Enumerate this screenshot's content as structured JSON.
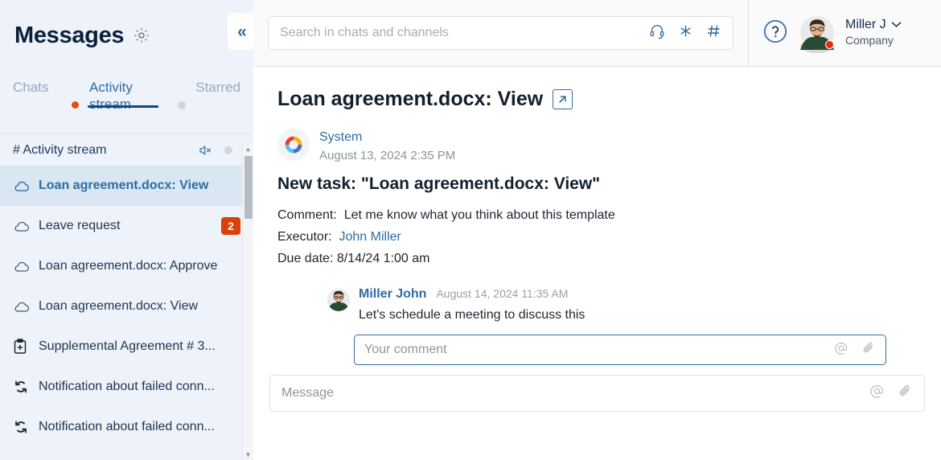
{
  "sidebar": {
    "title": "Messages",
    "gear_icon": "gear-icon",
    "collapse_icon": "double-chevron-left-icon",
    "tabs": [
      {
        "label": "Chats",
        "active": false,
        "dot": "none"
      },
      {
        "label": "Activity stream",
        "active": true,
        "dot": "red"
      },
      {
        "label": "Starred",
        "active": false,
        "dot": "gray"
      }
    ],
    "channel": {
      "name": "# Activity stream",
      "mute_icon": "mute-speaker-icon",
      "status_dot": "gray"
    },
    "items": [
      {
        "label": "Loan agreement.docx: View",
        "icon": "cloud-icon",
        "badge": "",
        "selected": true
      },
      {
        "label": "Leave request",
        "icon": "cloud-icon",
        "badge": "2",
        "selected": false
      },
      {
        "label": "Loan agreement.docx: Approve",
        "icon": "cloud-icon",
        "badge": "",
        "selected": false
      },
      {
        "label": "Loan agreement.docx: View",
        "icon": "cloud-icon",
        "badge": "",
        "selected": false
      },
      {
        "label": "Supplemental Agreement # 3...",
        "icon": "clipboard-plus-icon",
        "badge": "",
        "selected": false
      },
      {
        "label": "Notification about failed conn...",
        "icon": "sync-arrows-icon",
        "badge": "",
        "selected": false
      },
      {
        "label": "Notification about failed conn...",
        "icon": "sync-arrows-icon",
        "badge": "",
        "selected": false
      }
    ]
  },
  "topbar": {
    "search_placeholder": "Search in chats and channels",
    "search_value": "",
    "icons": [
      "headset-icon",
      "asterisk-icon",
      "hash-icon"
    ],
    "help_icon": "question-circle-icon",
    "profile": {
      "name": "Miller J",
      "company": "Company",
      "chevron": "chevron-down-icon",
      "status": "busy"
    }
  },
  "main": {
    "page_title": "Loan agreement.docx: View",
    "external_link_icon": "external-link-icon",
    "message": {
      "author": "System",
      "timestamp": "August 13, 2024 2:35 PM",
      "title": "New task: \"Loan agreement.docx: View\"",
      "comment_label": "Comment:",
      "comment_value": "Let me know what you think about this template",
      "executor_label": "Executor:",
      "executor_value": "John Miller",
      "due_label": "Due date:",
      "due_value": "8/14/24 1:00 am"
    },
    "reply": {
      "author": "Miller John",
      "timestamp": "August 14, 2024 11:35 AM",
      "text": "Let's schedule a meeting to discuss this"
    },
    "comment_input": {
      "placeholder": "Your comment",
      "value": "",
      "mention_icon": "at-icon",
      "attach_icon": "paperclip-icon"
    },
    "message_input": {
      "placeholder": "Message",
      "value": "",
      "mention_icon": "at-icon",
      "attach_icon": "paperclip-icon"
    }
  },
  "colors": {
    "accent_blue": "#2e6ca4",
    "badge_red": "#d9400b",
    "sidebar_bg": "#eef3fb",
    "selected_bg": "#d8e7f2",
    "status_red": "#e8290b"
  }
}
